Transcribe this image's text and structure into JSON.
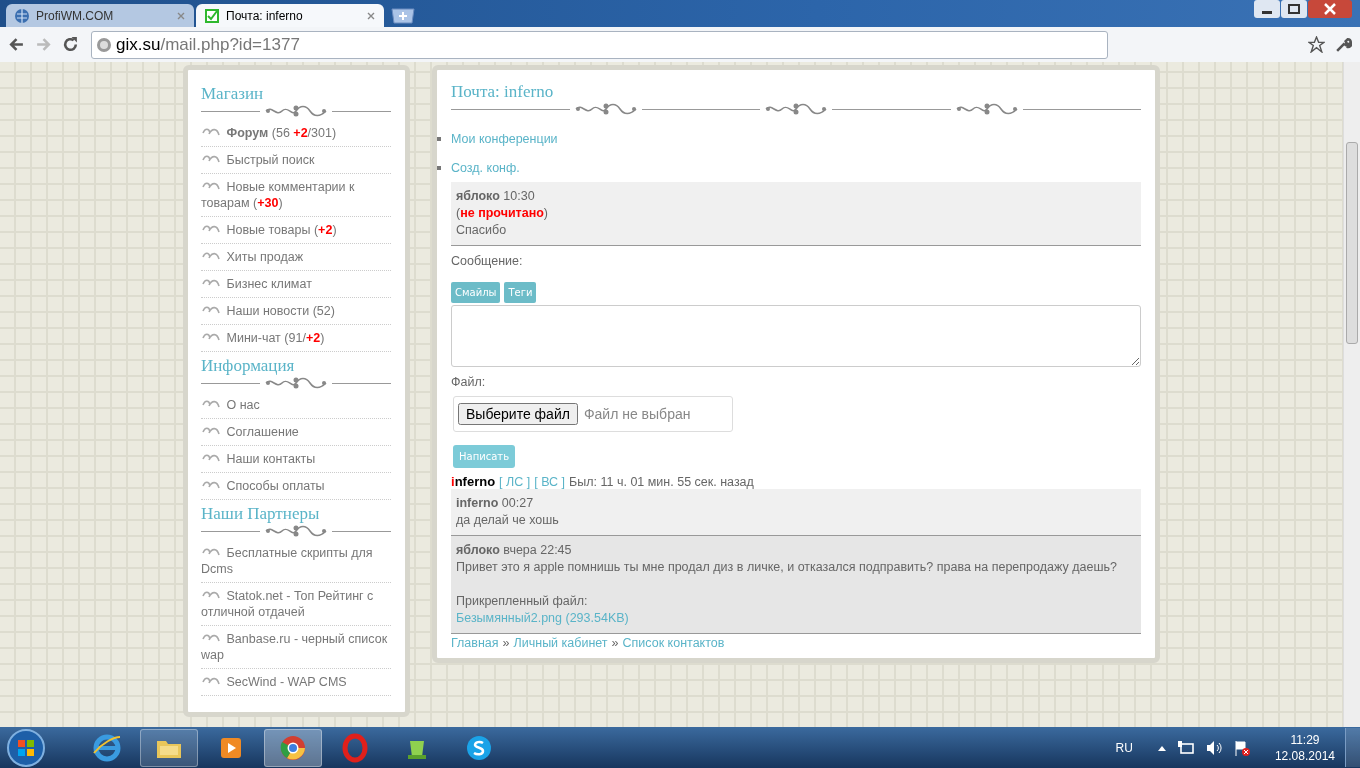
{
  "browser": {
    "tabs": [
      {
        "title": "ProfiWM.COM",
        "selected": false
      },
      {
        "title": "Почта: inferno",
        "selected": true
      }
    ],
    "url": {
      "host": "gix.su",
      "path": "/mail.php?id=1377"
    }
  },
  "sidebar": [
    {
      "title": "Магазин",
      "items": [
        {
          "label": "Форум",
          "bold": true,
          "count": "(56 **+2**/301)"
        },
        {
          "label": "Быстрый поиск",
          "bold": false
        },
        {
          "label": "Новые комментарии к товарам",
          "bold": false,
          "count": "(**+30**)"
        },
        {
          "label": "Новые товары",
          "bold": false,
          "count": "(**+2**)"
        },
        {
          "label": "Хиты продаж",
          "bold": false
        },
        {
          "label": "Бизнес климат",
          "bold": false
        },
        {
          "label": "Наши новости",
          "bold": false,
          "count": "(52)"
        },
        {
          "label": "Мини-чат",
          "bold": false,
          "count": "(91/**+2**)"
        }
      ]
    },
    {
      "title": "Информация",
      "items": [
        {
          "label": "О нас",
          "bold": false
        },
        {
          "label": "Соглашение",
          "bold": false
        },
        {
          "label": "Наши контакты",
          "bold": false
        },
        {
          "label": "Способы оплаты",
          "bold": false
        }
      ]
    },
    {
      "title": "Наши Партнеры",
      "items": [
        {
          "label": "Бесплатные скрипты для Dcms",
          "bold": false
        },
        {
          "label": "Statok.net - Топ Рейтинг с отличной отдачей",
          "bold": false
        },
        {
          "label": "Banbase.ru - черный список wap",
          "bold": false
        },
        {
          "label": "SecWind - WAP CMS",
          "bold": false
        }
      ]
    }
  ],
  "main": {
    "title": "Почта: inferno",
    "links": [
      "Мои конференции",
      "Созд. конф."
    ],
    "last_sent": {
      "author": "яблоко",
      "time": "10:30",
      "unread": "(**не прочитано**)",
      "text": "Спасибо"
    },
    "form": {
      "message_label": "Сообщение:",
      "tool_buttons": [
        "Смайлы",
        "Теги"
      ],
      "file_label": "Файл:",
      "file_button": "Выберите файл",
      "file_status": "Файл не выбран",
      "submit": "Написать"
    },
    "contact": {
      "name_initial": "i",
      "name_rest": "nferno",
      "links": [
        "[ ЛС ]",
        "[ ВС ]"
      ],
      "status": "Был: 11 ч. 01 мин. 55 сек. назад"
    },
    "messages": [
      {
        "author": "inferno",
        "time": "00:27",
        "text": "да делай че хошь"
      },
      {
        "author": "яблоко",
        "time": "вчера 22:45",
        "text": "Привет это я apple помнишь ты мне продал диз в личке, и отказался подправить? права на перепродажу даешь?",
        "attachment_label": "Прикрепленный файл:",
        "attachment": "Безымянный2.png (293.54KB)"
      }
    ],
    "breadcrumbs": [
      "Главная",
      "Личный кабинет",
      "Список контактов"
    ],
    "breadcrumb_separator": "»"
  },
  "taskbar": {
    "language": "RU",
    "time": "11:29",
    "date": "12.08.2014"
  }
}
